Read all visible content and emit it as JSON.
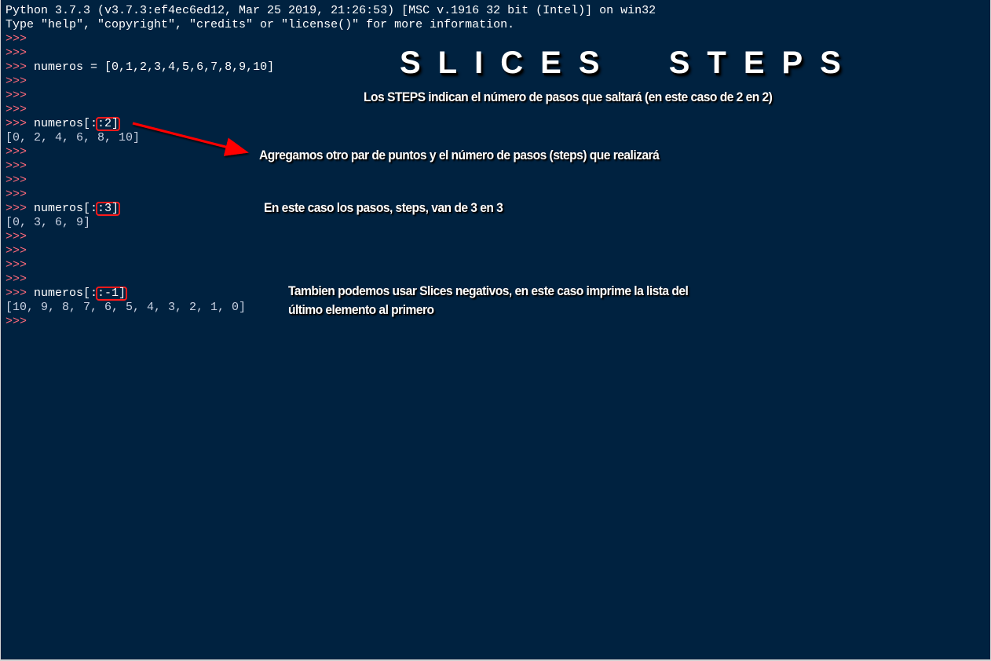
{
  "console": {
    "banner_line1": "Python 3.7.3 (v3.7.3:ef4ec6ed12, Mar 25 2019, 21:26:53) [MSC v.1916 32 bit (Intel)] on win32",
    "banner_line2": "Type \"help\", \"copyright\", \"credits\" or \"license()\" for more information.",
    "prompt": ">>>",
    "assign_code": "numeros = [0,1,2,3,4,5,6,7,8,9,10]",
    "cmd1_prefix": "numeros[:",
    "cmd1_highlight": ":2]",
    "out1": "[0, 2, 4, 6, 8, 10]",
    "cmd2_prefix": "numeros[:",
    "cmd2_highlight": ":3]",
    "out2": "[0, 3, 6, 9]",
    "cmd3_prefix": "numeros[:",
    "cmd3_highlight": ":-1]",
    "out3": "[10, 9, 8, 7, 6, 5, 4, 3, 2, 1, 0]"
  },
  "annotations": {
    "title": "SLICES  STEPS",
    "subtitle": "Los STEPS indican el número de pasos que saltará (en este caso de 2 en 2)",
    "note1": "Agregamos otro par de puntos y el número de pasos (steps) que realizará",
    "note2": "En este caso los pasos, steps, van de 3 en 3",
    "note3_line1": "Tambien podemos usar Slices negativos, en este caso imprime la lista del",
    "note3_line2": "último elemento al primero"
  },
  "colors": {
    "background": "#002240",
    "prompt": "#ff6a7a",
    "highlight": "#ff1a1a",
    "arrow": "#ff0000"
  }
}
